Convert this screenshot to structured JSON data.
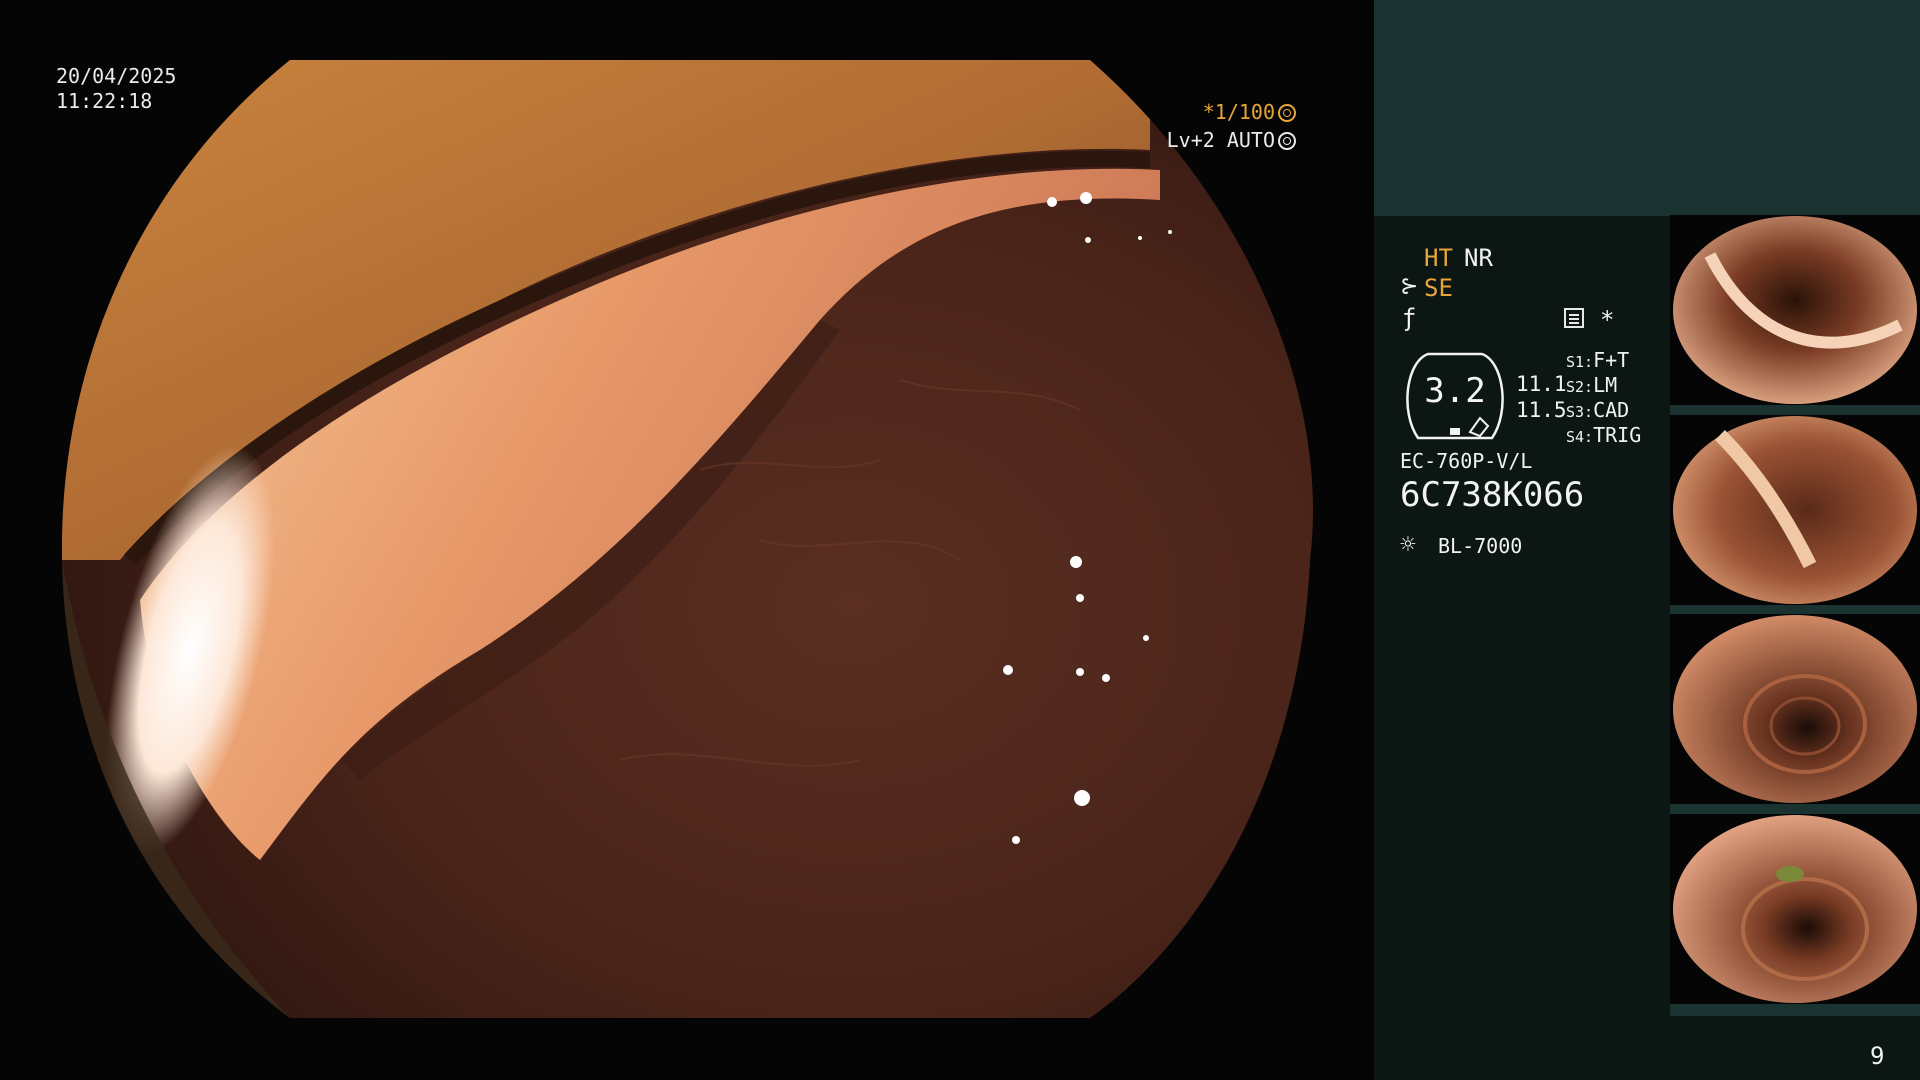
{
  "overlay": {
    "date": "20/04/2025",
    "time": "11:22:18",
    "shutter": "*1/100",
    "level": "Lv+2 AUTO"
  },
  "settings": {
    "ht": "HT",
    "nr": "NR",
    "se": "SE",
    "star": "*",
    "zoom": "3.2",
    "value_1": "11.1",
    "value_2": "11.5",
    "slots": [
      {
        "key": "S1:",
        "value": "F+T"
      },
      {
        "key": "S2:",
        "value": "LM"
      },
      {
        "key": "S3:",
        "value": "CAD"
      },
      {
        "key": "S4:",
        "value": "TRIG"
      }
    ],
    "model": "EC-760P-V/L",
    "serial": "6C738K066",
    "light_source": "BL-7000"
  },
  "page_number": "9",
  "icons": {
    "shutter": "aperture-icon",
    "level": "iris-icon",
    "se": "scope-connector-icon",
    "f": "freeze-icon",
    "memo": "memo-icon",
    "lamp": "light-bulb-icon"
  },
  "colors": {
    "accent": "#e8a63a",
    "panel": "#0c1714",
    "panel_header": "#1a3331"
  }
}
